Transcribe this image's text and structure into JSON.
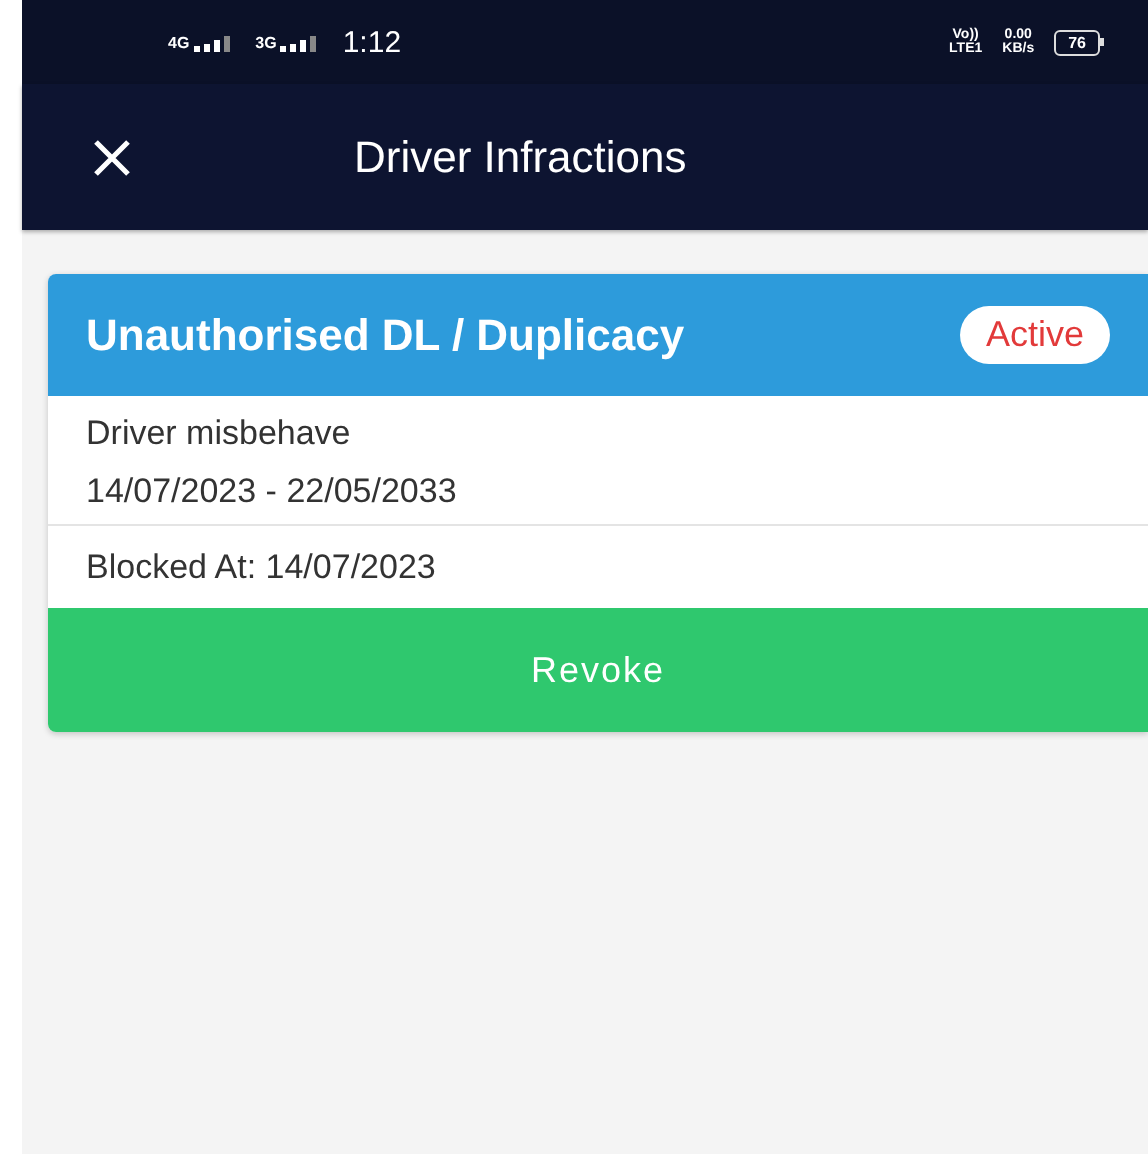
{
  "status_bar": {
    "network_1": "4G",
    "network_2": "3G",
    "time": "1:12",
    "volte_top": "Vo))",
    "volte_bottom": "LTE1",
    "speed_value": "0.00",
    "speed_unit": "KB/s",
    "battery": "76"
  },
  "app_bar": {
    "title": "Driver Infractions"
  },
  "infraction": {
    "title": "Unauthorised DL / Duplicacy",
    "status": "Active",
    "reason": "Driver misbehave",
    "period": "14/07/2023 - 22/05/2033",
    "blocked_at": "Blocked At: 14/07/2023",
    "action": "Revoke"
  }
}
